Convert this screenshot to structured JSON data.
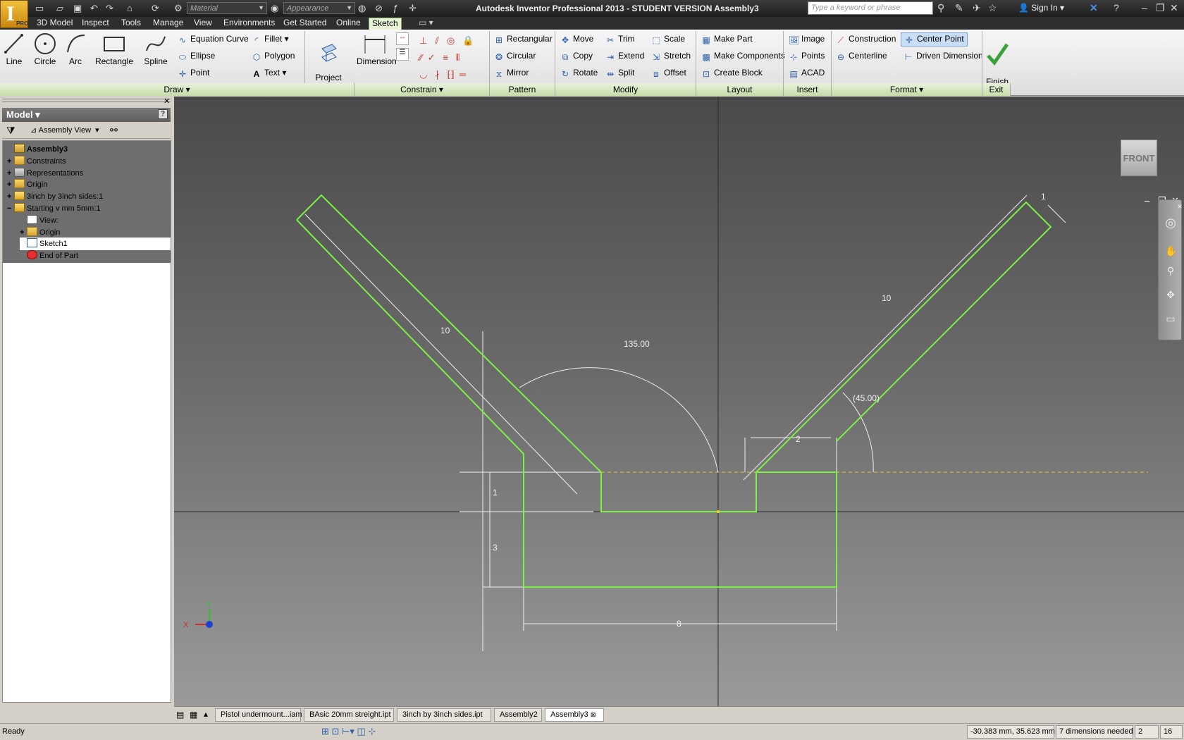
{
  "titlebar": {
    "title": "Autodesk Inventor Professional 2013 - STUDENT VERSION    Assembly3",
    "material_placeholder": "Material",
    "appearance_placeholder": "Appearance",
    "search_placeholder": "Type a keyword or phrase",
    "signin": "Sign In",
    "app_letter": "I",
    "app_badge": "PRO"
  },
  "menu": {
    "tabs": [
      "3D Model",
      "Inspect",
      "Tools",
      "Manage",
      "View",
      "Environments",
      "Get Started",
      "Online",
      "Sketch"
    ],
    "active": "Sketch"
  },
  "ribbon": {
    "draw": {
      "line": "Line",
      "circle": "Circle",
      "arc": "Arc",
      "rectangle": "Rectangle",
      "spline": "Spline",
      "equation_curve": "Equation Curve",
      "ellipse": "Ellipse",
      "point": "Point",
      "fillet": "Fillet",
      "polygon": "Polygon",
      "text": "Text",
      "label": "Draw"
    },
    "project_geometry": "Project\nGeometry",
    "constrain": {
      "dimension": "Dimension",
      "label": "Constrain"
    },
    "pattern": {
      "rectangular": "Rectangular",
      "circular": "Circular",
      "mirror": "Mirror",
      "label": "Pattern"
    },
    "modify": {
      "move": "Move",
      "copy": "Copy",
      "rotate": "Rotate",
      "trim": "Trim",
      "extend": "Extend",
      "split": "Split",
      "scale": "Scale",
      "stretch": "Stretch",
      "offset": "Offset",
      "label": "Modify"
    },
    "layout": {
      "make_part": "Make Part",
      "make_components": "Make Components",
      "create_block": "Create Block",
      "label": "Layout"
    },
    "insert": {
      "image": "Image",
      "points": "Points",
      "acad": "ACAD",
      "label": "Insert"
    },
    "format": {
      "construction": "Construction",
      "centerline": "Centerline",
      "center_point": "Center Point",
      "driven_dimension": "Driven Dimension",
      "label": "Format"
    },
    "exit": {
      "finish_sketch": "Finish\nSketch",
      "label": "Exit"
    }
  },
  "browser": {
    "header": "Model",
    "view_selector": "Assembly View",
    "help": "?",
    "tree": [
      {
        "label": "Assembly3",
        "bold": true,
        "expand": "",
        "level": 0,
        "icon": "assembly-icon"
      },
      {
        "label": "Constraints",
        "expand": "+",
        "level": 0,
        "icon": "folder-icon"
      },
      {
        "label": "Representations",
        "expand": "+",
        "level": 0,
        "icon": "representations-icon"
      },
      {
        "label": "Origin",
        "expand": "+",
        "level": 0,
        "icon": "folder-icon"
      },
      {
        "label": "3inch by 3inch sides:1",
        "expand": "+",
        "level": 0,
        "icon": "part-icon"
      },
      {
        "label": "Starting v mm 5mm:1",
        "expand": "−",
        "level": 0,
        "icon": "part-icon"
      },
      {
        "label": "View:",
        "expand": "",
        "level": 1,
        "icon": "view-icon"
      },
      {
        "label": "Origin",
        "expand": "+",
        "level": 1,
        "icon": "folder-icon"
      },
      {
        "label": "Sketch1",
        "expand": "",
        "level": 1,
        "icon": "sketch-icon"
      },
      {
        "label": "End of Part",
        "expand": "",
        "level": 1,
        "icon": "end-of-part-icon"
      }
    ]
  },
  "viewport": {
    "viewcube_face": "FRONT",
    "dimensions": {
      "left_arm_length": "10",
      "right_arm_length": "10",
      "arm_width": "1",
      "angle_left": "135.00",
      "angle_right": "(45.00)",
      "top_gap": "2",
      "height_small": "1",
      "height_block": "3",
      "base_width": "8"
    },
    "axis_x": "X",
    "axis_y": "Y",
    "colors": {
      "geometry": "#7cf043",
      "dimension": "#f0f0f0",
      "construction": "#e8c830",
      "axis": "#2a2a2a"
    }
  },
  "documents": {
    "tabs": [
      "Pistol undermount...iam",
      "BAsic 20mm streight.ipt",
      "3inch by 3inch sides.ipt",
      "Assembly2",
      "Assembly3"
    ],
    "active": "Assembly3"
  },
  "status": {
    "text": "Ready",
    "coords": "-30.383 mm, 35.623 mm",
    "dimensions_needed": "7 dimensions needed",
    "count_a": "2",
    "count_b": "16"
  }
}
